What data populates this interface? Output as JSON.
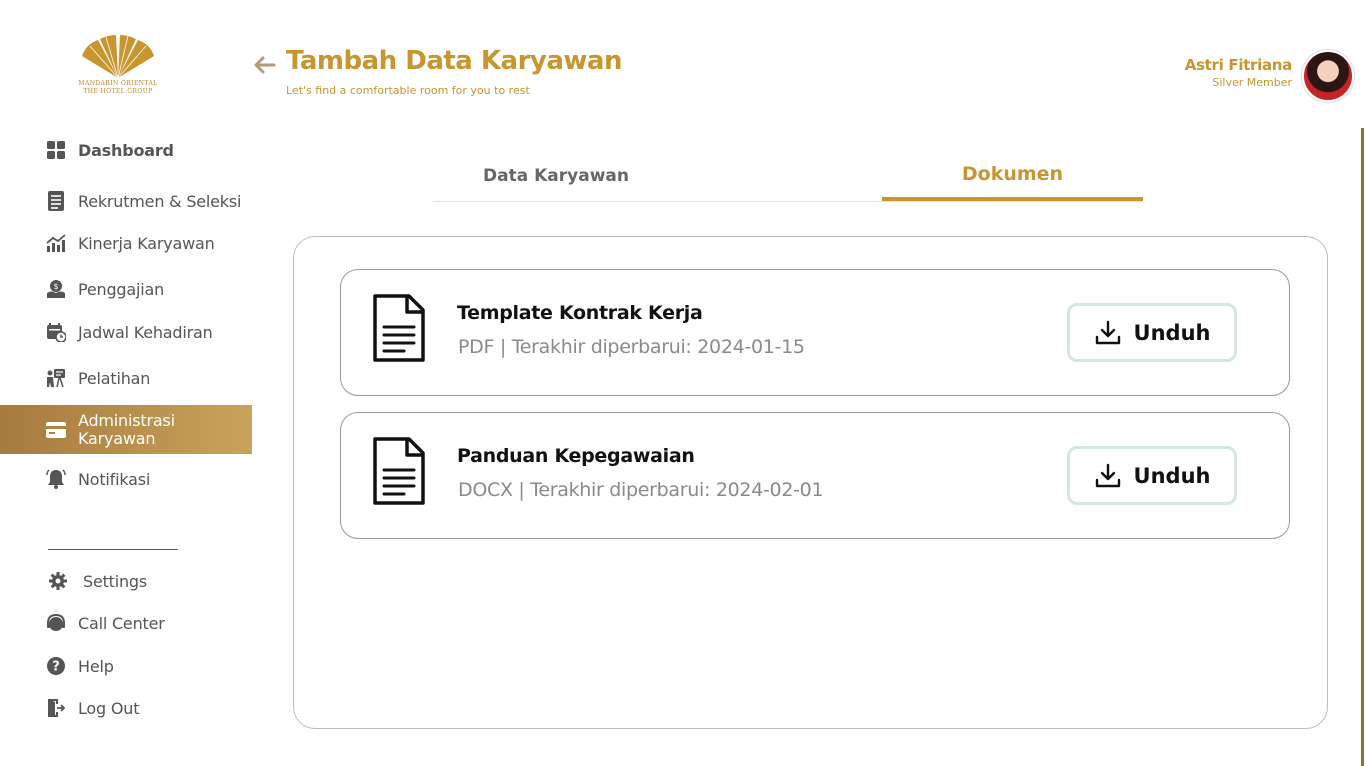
{
  "brand": {
    "line1": "MANDARIN ORIENTAL",
    "line2": "THE HOTEL GROUP",
    "logo_icon": "fan-logo-icon",
    "accent": "#c8952f"
  },
  "header": {
    "back_icon": "arrow-left-icon",
    "title": "Tambah Data Karyawan",
    "subtitle": "Let's find a comfortable room for you to rest"
  },
  "user": {
    "name": "Astri Fitriana",
    "tier": "Silver Member",
    "avatar_icon": "avatar"
  },
  "sidebar": {
    "items": [
      {
        "label": "Dashboard",
        "icon": "dashboard-grid-icon"
      },
      {
        "label": "Rekrutmen & Seleksi",
        "icon": "clipboard-list-icon"
      },
      {
        "label": "Kinerja Karyawan",
        "icon": "chart-trend-icon"
      },
      {
        "label": "Penggajian",
        "icon": "payroll-icon"
      },
      {
        "label": "Jadwal Kehadiran",
        "icon": "calendar-clock-icon"
      },
      {
        "label": "Pelatihan",
        "icon": "training-icon"
      },
      {
        "label": "Administrasi Karyawan",
        "icon": "id-card-icon",
        "active": true
      },
      {
        "label": "Notifikasi",
        "icon": "bell-icon"
      }
    ],
    "bottom_items": [
      {
        "label": "Settings",
        "icon": "gear-icon"
      },
      {
        "label": "Call Center",
        "icon": "headset-icon"
      },
      {
        "label": "Help",
        "icon": "help-icon"
      },
      {
        "label": "Log Out",
        "icon": "logout-icon"
      }
    ],
    "active_color": "#b0843f"
  },
  "tabs": [
    {
      "label": "Data Karyawan",
      "active": false
    },
    {
      "label": "Dokumen",
      "active": true
    }
  ],
  "documents": [
    {
      "name": "Template Kontrak Kerja",
      "meta": "PDF | Terakhir diperbarui: 2024-01-15",
      "button": "Unduh",
      "icon": "document-icon"
    },
    {
      "name": "Panduan Kepegawaian",
      "meta": "DOCX | Terakhir diperbarui: 2024-02-01",
      "button": "Unduh",
      "icon": "document-icon"
    }
  ]
}
